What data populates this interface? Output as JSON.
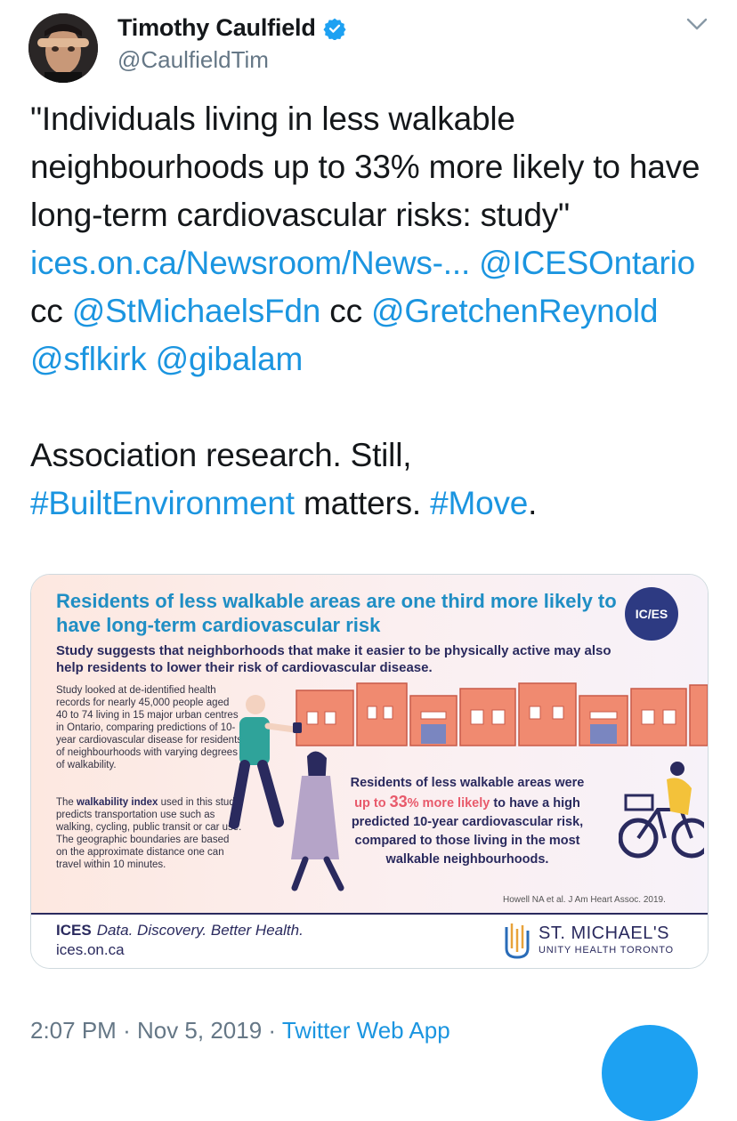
{
  "tweet": {
    "author_name": "Timothy Caulfield",
    "author_handle": "@CaulfieldTim",
    "quote": "\"Individuals living in less walkable neighbourhoods up to 33% more likely to have long-term cardiovascular risks: study\"",
    "link": "ices.on.ca/Newsroom/News-...",
    "mention_1": "@ICESOntario",
    "cc_1": "cc",
    "mention_2": "@StMichaelsFdn",
    "cc_2": "cc",
    "mention_3": "@GretchenReynold",
    "mention_4": "@sflkirk",
    "mention_5": "@gibalam",
    "para2_a": "Association research. Still,",
    "hashtag_1": "#BuiltEnvironment",
    "para2_b": "matters.",
    "hashtag_2": "#Move",
    "para2_end": ".",
    "time": "2:07 PM",
    "dot_1": "·",
    "date": "Nov 5, 2019",
    "dot_2": "·",
    "source": "Twitter Web App"
  },
  "infographic": {
    "title": "Residents of less walkable areas are one third more likely to have long-term cardiovascular risk",
    "subtitle": "Study suggests that neighborhoods that make it easier to be physically active may also help residents to lower their risk of cardiovascular disease.",
    "badge": "IC/ES",
    "body_1": "Study looked at de-identified health records for nearly 45,000 people aged 40 to 74 living in 15 major urban centres in Ontario, comparing predictions of 10-year cardiovascular disease for residents of neighbourhoods with varying degrees of walkability.",
    "body_2_pre": "The ",
    "body_2_bold": "walkability index",
    "body_2_post": " used in this study predicts transportation use such as walking, cycling, public transit or car use. The geographic boundaries are based on the approximate distance one can travel within 10 minutes.",
    "stat_1": "Residents of less walkable areas were",
    "stat_up": "up to ",
    "stat_num": "33",
    "stat_pct": "% more likely",
    "stat_2": " to have a high predicted 10-year cardiovascular risk, compared to those living in the most walkable neighbourhoods.",
    "citation": "Howell NA et al. J Am Heart Assoc. 2019.",
    "footer_brand": "ICES",
    "footer_tagline": "Data. Discovery. Better Health.",
    "footer_url": "ices.on.ca",
    "partner_name": "ST. MICHAEL'S",
    "partner_sub": "UNITY HEALTH TORONTO"
  },
  "colors": {
    "link": "#1b95e0",
    "verified": "#1da1f2",
    "title_blue": "#1f8ec4",
    "navy": "#2a2a5e",
    "highlight": "#e85a6b"
  },
  "icons": [
    "verified-badge-icon",
    "chevron-down-icon"
  ]
}
